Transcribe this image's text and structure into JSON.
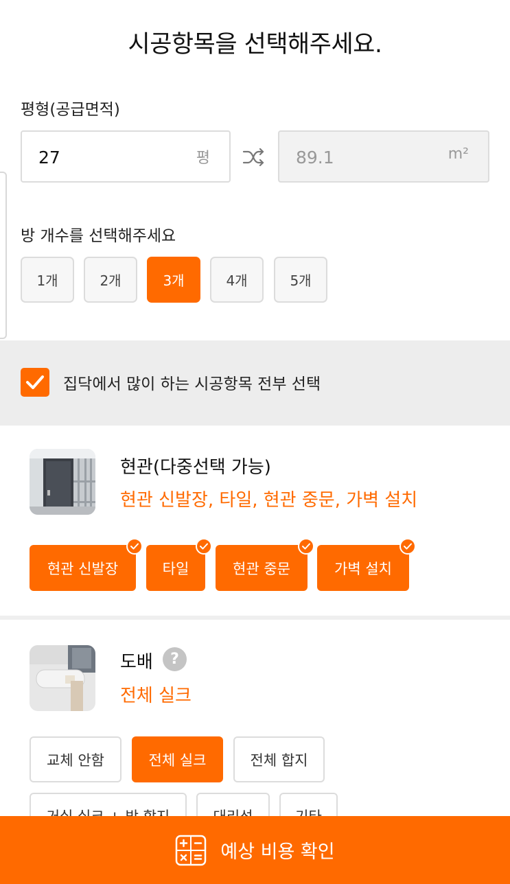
{
  "header": {
    "title": "시공항목을 선택해주세요."
  },
  "area": {
    "label": "평형(공급면적)",
    "pyeong_value": "27",
    "pyeong_unit": "평",
    "sqm_value": "89.1",
    "sqm_unit": "m²"
  },
  "rooms": {
    "label": "방 개수를 선택해주세요",
    "options": [
      "1개",
      "2개",
      "3개",
      "4개",
      "5개"
    ],
    "selected": "3개"
  },
  "select_all": {
    "label": "집닥에서 많이 하는 시공항목 전부 선택",
    "checked": true
  },
  "sections": [
    {
      "title": "현관(다중선택 가능)",
      "summary": "현관 신발장, 타일, 현관 중문, 가벽 설치",
      "chips": [
        {
          "label": "현관 신발장",
          "selected": true
        },
        {
          "label": "타일",
          "selected": true
        },
        {
          "label": "현관 중문",
          "selected": true
        },
        {
          "label": "가벽 설치",
          "selected": true
        }
      ]
    },
    {
      "title": "도배",
      "help": "?",
      "summary": "전체 실크",
      "chips": [
        {
          "label": "교체 안함",
          "selected": false
        },
        {
          "label": "전체 실크",
          "selected": true
        },
        {
          "label": "전체 합지",
          "selected": false
        },
        {
          "label": "거실 실크 + 방 합지",
          "selected": false
        },
        {
          "label": "대리석",
          "selected": false
        },
        {
          "label": "기타",
          "selected": false
        }
      ]
    }
  ],
  "footer": {
    "button_label": "예상 비용 확인"
  },
  "colors": {
    "accent": "#ff6a00",
    "band": "#ededed",
    "border": "#dcdcdc"
  }
}
